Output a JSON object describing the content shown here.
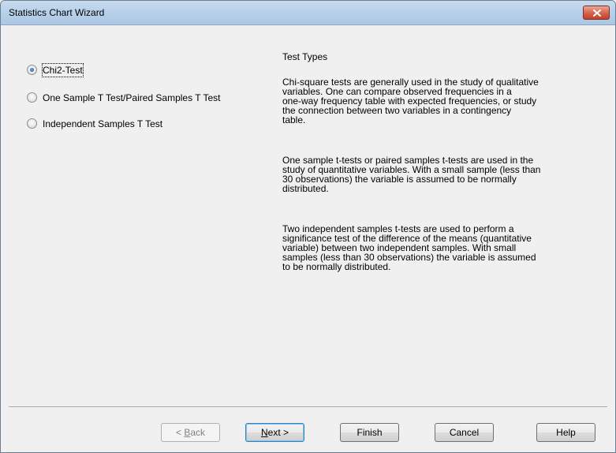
{
  "window": {
    "title": "Statistics Chart Wizard"
  },
  "test_options": [
    {
      "label": "Chi2-Test",
      "selected": true
    },
    {
      "label": "One Sample T Test/Paired Samples T Test",
      "selected": false
    },
    {
      "label": "Independent Samples T Test",
      "selected": false
    }
  ],
  "description": {
    "heading": "Test Types",
    "paragraphs": [
      [
        "Chi-square tests are generally used in the study of qualitative",
        "variables. One can compare observed frequencies in a",
        "one-way frequency table with expected frequencies, or study",
        "the connection between two variables in a contingency",
        "table."
      ],
      [
        "One sample t-tests or paired samples t-tests are used in the",
        "study of quantitative variables. With a small sample (less than",
        "30 observations) the variable is assumed to be normally",
        "distributed."
      ],
      [
        "Two independent samples t-tests are used to perform a",
        "significance test of the difference of the means (quantitative",
        "variable) between two independent samples. With small",
        "samples (less than 30 observations) the variable is assumed",
        "to be normally distributed."
      ]
    ]
  },
  "buttons": {
    "back": {
      "prefix": "< ",
      "mnemonic": "B",
      "rest": "ack",
      "enabled": false
    },
    "next": {
      "mnemonic": "N",
      "rest": "ext >",
      "default": true
    },
    "finish": "Finish",
    "cancel": "Cancel",
    "help": "Help"
  }
}
